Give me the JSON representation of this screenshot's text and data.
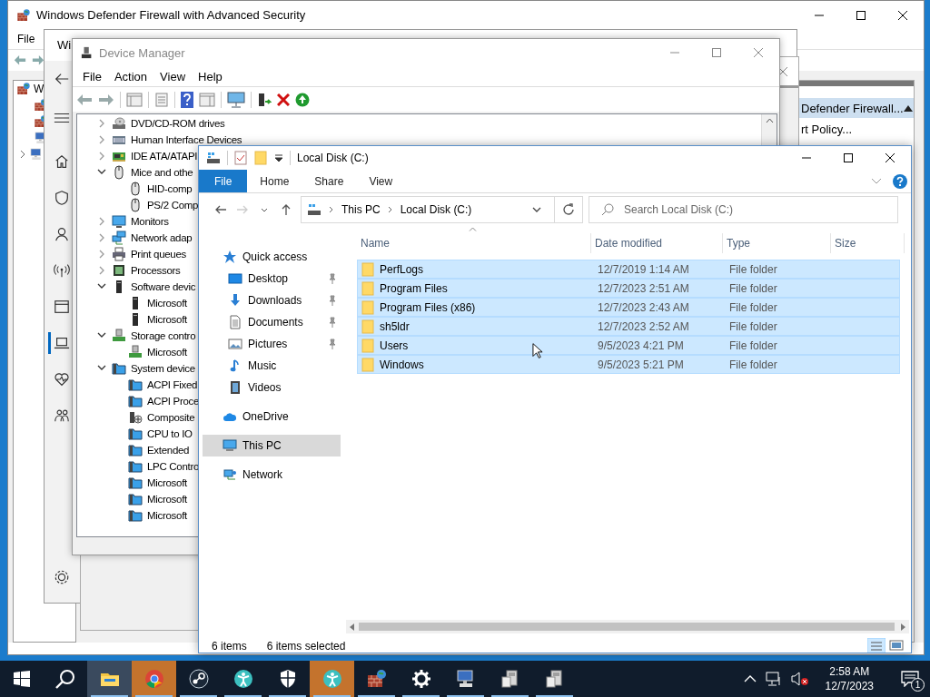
{
  "firewall_window": {
    "title": "Windows Defender Firewall with Advanced Security",
    "menu": [
      "File"
    ],
    "tree": [
      {
        "label": "W"
      }
    ],
    "actions": {
      "header": "Defender Firewall...",
      "items": [
        "rt Policy..."
      ]
    }
  },
  "security_window": {
    "title": "Wi",
    "nav": [
      {
        "kind": "home",
        "selected": false
      },
      {
        "kind": "shield",
        "selected": false
      },
      {
        "kind": "account",
        "selected": false
      },
      {
        "kind": "network",
        "selected": false
      },
      {
        "kind": "app",
        "selected": false
      },
      {
        "kind": "device",
        "selected": true
      },
      {
        "kind": "health",
        "selected": false
      },
      {
        "kind": "family",
        "selected": false
      }
    ]
  },
  "device_manager": {
    "title": "Device Manager",
    "menu": [
      "File",
      "Action",
      "View",
      "Help"
    ],
    "tree": [
      {
        "label": "DVD/CD-ROM drives",
        "kind": "dvd",
        "expanded": false
      },
      {
        "label": "Human Interface Devices",
        "kind": "hid",
        "expanded": false
      },
      {
        "label": "IDE ATA/ATAPI",
        "kind": "ide",
        "expanded": false
      },
      {
        "label": "Mice and othe",
        "kind": "mouse",
        "expanded": true,
        "children": [
          {
            "label": "HID-comp",
            "kind": "mouse"
          },
          {
            "label": "PS/2 Comp",
            "kind": "mouse"
          }
        ]
      },
      {
        "label": "Monitors",
        "kind": "monitor",
        "expanded": false
      },
      {
        "label": "Network adap",
        "kind": "network",
        "expanded": false
      },
      {
        "label": "Print queues",
        "kind": "printer",
        "expanded": false
      },
      {
        "label": "Processors",
        "kind": "processor",
        "expanded": false
      },
      {
        "label": "Software devic",
        "kind": "software",
        "expanded": true,
        "children": [
          {
            "label": "Microsoft",
            "kind": "software"
          },
          {
            "label": "Microsoft",
            "kind": "software"
          }
        ]
      },
      {
        "label": "Storage contro",
        "kind": "storage",
        "expanded": true,
        "children": [
          {
            "label": "Microsoft",
            "kind": "storage"
          }
        ]
      },
      {
        "label": "System device",
        "kind": "system",
        "expanded": true,
        "children": [
          {
            "label": "ACPI Fixed",
            "kind": "system"
          },
          {
            "label": "ACPI Proce",
            "kind": "system"
          },
          {
            "label": "Composite",
            "kind": "composite"
          },
          {
            "label": "CPU to IO",
            "kind": "system"
          },
          {
            "label": "Extended",
            "kind": "system"
          },
          {
            "label": "LPC Contro",
            "kind": "system"
          },
          {
            "label": "Microsoft",
            "kind": "system"
          },
          {
            "label": "Microsoft",
            "kind": "system"
          },
          {
            "label": "Microsoft",
            "kind": "system"
          }
        ]
      }
    ]
  },
  "explorer": {
    "title": "Local Disk (C:)",
    "ribbon_tabs": [
      {
        "label": "File",
        "selected": true
      },
      {
        "label": "Home",
        "selected": false
      },
      {
        "label": "Share",
        "selected": false
      },
      {
        "label": "View",
        "selected": false
      }
    ],
    "breadcrumb": [
      "This PC",
      "Local Disk (C:)"
    ],
    "search": {
      "placeholder": "Search Local Disk (C:)"
    },
    "nav": [
      {
        "label": "Quick access",
        "kind": "star",
        "selected": false,
        "children": [
          {
            "label": "Desktop",
            "kind": "desktop",
            "pinned": true,
            "selected": false
          },
          {
            "label": "Downloads",
            "kind": "downloads",
            "pinned": true,
            "selected": false
          },
          {
            "label": "Documents",
            "kind": "documents",
            "pinned": true,
            "selected": false
          },
          {
            "label": "Pictures",
            "kind": "pictures",
            "pinned": true,
            "selected": false
          },
          {
            "label": "Music",
            "kind": "music",
            "pinned": false,
            "selected": false
          },
          {
            "label": "Videos",
            "kind": "videos",
            "pinned": false,
            "selected": false
          }
        ]
      },
      {
        "label": "OneDrive",
        "kind": "cloud",
        "selected": false
      },
      {
        "label": "This PC",
        "kind": "pc",
        "selected": true
      },
      {
        "label": "Network",
        "kind": "network",
        "selected": false
      }
    ],
    "columns": [
      "Name",
      "Date modified",
      "Type",
      "Size"
    ],
    "rows": [
      {
        "name": "PerfLogs",
        "date": "12/7/2019 1:14 AM",
        "type": "File folder",
        "selected": true
      },
      {
        "name": "Program Files",
        "date": "12/7/2023 2:51 AM",
        "type": "File folder",
        "selected": true
      },
      {
        "name": "Program Files (x86)",
        "date": "12/7/2023 2:43 AM",
        "type": "File folder",
        "selected": true
      },
      {
        "name": "sh5ldr",
        "date": "12/7/2023 2:52 AM",
        "type": "File folder",
        "selected": true
      },
      {
        "name": "Users",
        "date": "9/5/2023 4:21 PM",
        "type": "File folder",
        "selected": true
      },
      {
        "name": "Windows",
        "date": "9/5/2023 5:21 PM",
        "type": "File folder",
        "selected": true
      }
    ],
    "status": {
      "count": "6 items",
      "selection": "6 items selected"
    }
  },
  "taskbar": {
    "apps": [
      {
        "kind": "explorer",
        "active": true,
        "attention": false
      },
      {
        "kind": "browser",
        "active": false,
        "attention": true
      },
      {
        "kind": "round",
        "active": false,
        "attention": false
      },
      {
        "kind": "person",
        "active": false,
        "attention": false
      },
      {
        "kind": "shield",
        "active": false,
        "attention": false
      },
      {
        "kind": "person",
        "active": false,
        "attention": true
      },
      {
        "kind": "firewall",
        "active": false,
        "attention": false
      },
      {
        "kind": "gear",
        "active": false,
        "attention": false
      },
      {
        "kind": "computer",
        "active": false,
        "attention": false
      },
      {
        "kind": "server",
        "active": false,
        "attention": false
      },
      {
        "kind": "server",
        "active": false,
        "attention": false
      }
    ],
    "clock": {
      "time": "2:58 AM",
      "date": "12/7/2023"
    },
    "notification_count": "1"
  }
}
